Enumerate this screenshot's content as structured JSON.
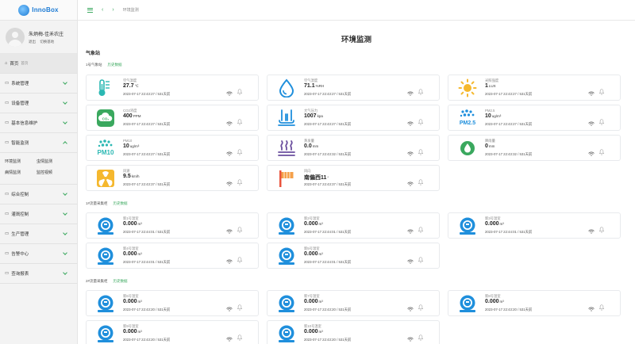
{
  "app": {
    "logo_text": "InnoBox"
  },
  "user": {
    "name": "朱炳梅-佳禾农庄",
    "logout": "退出",
    "switch_base": "切换基地"
  },
  "sidebar": {
    "home": {
      "label": "首页",
      "sub": "首页"
    },
    "items": [
      "系统管理",
      "设备管理",
      "基本信息维护",
      "智能监测"
    ],
    "sub_items": [
      "环境监测",
      "虫情监测",
      "病情监测",
      "监控视频"
    ],
    "items2": [
      "综合控制",
      "灌溉控制",
      "生产管理",
      "告警中心",
      "查询报表"
    ]
  },
  "topbar": {
    "breadcrumb": "环境监测"
  },
  "page": {
    "title": "环境监测",
    "section": "气象站"
  },
  "groups": [
    {
      "name": "1号气象站",
      "history": "历史数据"
    },
    {
      "name": "1#流量采集柜",
      "history": "历史数据"
    },
    {
      "name": "2#流量采集柜",
      "history": "历史数据"
    }
  ],
  "weather_cards": [
    {
      "label": "空气温度",
      "value": "27.7",
      "unit": "℃",
      "time": "2023-07-17 22:43:27 / 531天前",
      "icon": "thermometer-icon"
    },
    {
      "label": "空气湿度",
      "value": "71.1",
      "unit": "%RH",
      "time": "2023-07-17 22:43:27 / 531天前",
      "icon": "droplet-icon"
    },
    {
      "label": "光照强度",
      "value": "1",
      "unit": "LUX",
      "time": "2023-07-17 22:43:27 / 531天前",
      "icon": "sun-icon"
    },
    {
      "label": "CO2浓度",
      "value": "400",
      "unit": "PPM",
      "time": "2023-07-17 22:43:27 / 531天前",
      "icon": "co2-icon"
    },
    {
      "label": "大气压力",
      "value": "1007",
      "unit": "kpa",
      "time": "2023-07-17 22:43:27 / 531天前",
      "icon": "pressure-icon"
    },
    {
      "label": "PM2.5",
      "value": "10",
      "unit": "ug/m³",
      "time": "2023-07-17 22:43:27 / 531天前",
      "icon": "pm25-icon"
    },
    {
      "label": "PM10",
      "value": "10",
      "unit": "ug/m³",
      "time": "2023-07-17 22:43:27 / 531天前",
      "icon": "pm10-icon"
    },
    {
      "label": "蒸发量",
      "value": "0.0",
      "unit": "mm",
      "time": "2023-07-17 22:43:32 / 531天前",
      "icon": "evaporation-icon"
    },
    {
      "label": "降雨量",
      "value": "0",
      "unit": "mm",
      "time": "2023-07-17 22:43:32 / 531天前",
      "icon": "rain-icon"
    },
    {
      "label": "风速",
      "value": "9.5",
      "unit": "km/h",
      "time": "2023-07-17 22:43:37 / 531天前",
      "icon": "fan-icon"
    },
    {
      "label": "风向",
      "value": "南偏西11",
      "unit": "°",
      "time": "2023-07-17 22:43:37 / 531天前",
      "icon": "wind-vane-icon"
    }
  ],
  "flow_group1": [
    {
      "label": "新1号温室",
      "value": "0.000",
      "unit": "m³",
      "time": "2023-07-17 22:44:01 / 531天前"
    },
    {
      "label": "新2号温室",
      "value": "0.000",
      "unit": "m³",
      "time": "2023-07-17 22:44:01 / 531天前"
    },
    {
      "label": "新3号温室",
      "value": "0.000",
      "unit": "m³",
      "time": "2023-07-17 22:44:01 / 531天前"
    },
    {
      "label": "新4号温室",
      "value": "0.000",
      "unit": "m³",
      "time": "2023-07-17 22:44:01 / 531天前"
    },
    {
      "label": "新5号温室",
      "value": "0.000",
      "unit": "m³",
      "time": "2023-07-17 22:44:01 / 531天前"
    }
  ],
  "flow_group2": [
    {
      "label": "新6号温室",
      "value": "0.000",
      "unit": "m³",
      "time": "2023-07-17 22:43:20 / 531天前"
    },
    {
      "label": "新7号温室",
      "value": "0.000",
      "unit": "m³",
      "time": "2023-07-17 22:43:20 / 531天前"
    },
    {
      "label": "新8号温室",
      "value": "0.000",
      "unit": "m³",
      "time": "2023-07-17 22:43:20 / 531天前"
    },
    {
      "label": "新9号温室",
      "value": "0.000",
      "unit": "m³",
      "time": "2023-07-17 22:43:20 / 531天前"
    },
    {
      "label": "新10号温室",
      "value": "0.000",
      "unit": "m³",
      "time": "2023-07-17 22:43:20 / 531天前"
    }
  ],
  "colors": {
    "accent": "#3aa85e",
    "icon_blue": "#1f8fdc",
    "icon_teal": "#2bb8b3",
    "icon_yellow": "#f5b82e",
    "icon_green": "#3aa85e",
    "icon_red": "#e9533c"
  }
}
